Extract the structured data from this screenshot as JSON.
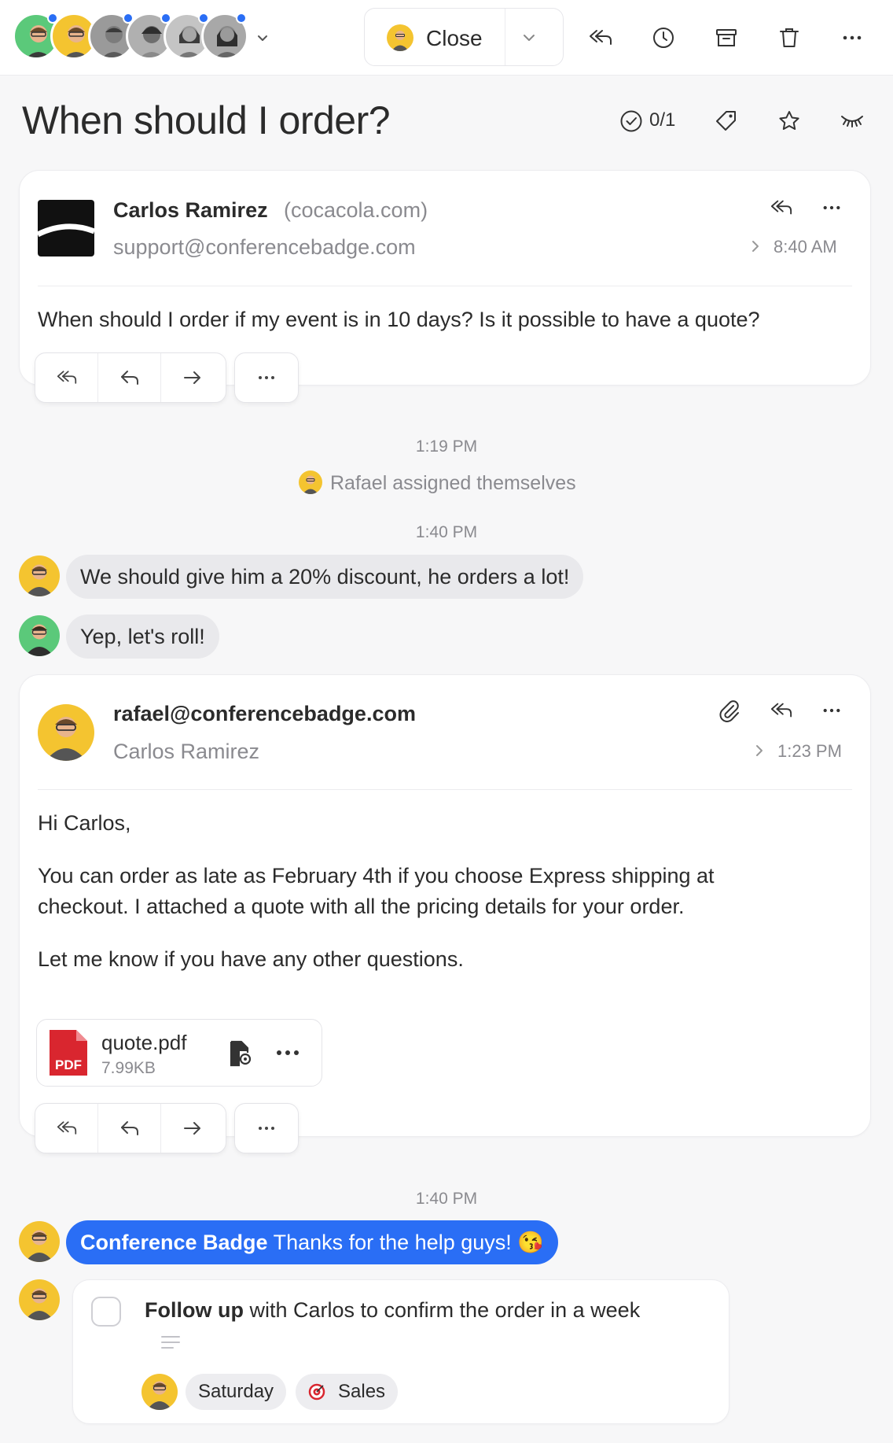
{
  "toolbar": {
    "close_label": "Close",
    "avatars": [
      {
        "name": "avatar-1",
        "bg": "#5bc97a",
        "presence": true
      },
      {
        "name": "avatar-2",
        "bg": "#f4c430",
        "presence": false
      },
      {
        "name": "avatar-3",
        "bg": "#9a9a9a",
        "presence": true
      },
      {
        "name": "avatar-4",
        "bg": "#b0b0b0",
        "presence": true
      },
      {
        "name": "avatar-5",
        "bg": "#c4c4c4",
        "presence": true
      },
      {
        "name": "avatar-6",
        "bg": "#a8a8a8",
        "presence": true
      }
    ]
  },
  "title": {
    "text": "When should I order?",
    "task_count": "0/1"
  },
  "email1": {
    "sender": "Carlos Ramirez",
    "domain": "(cocacola.com)",
    "to": "support@conferencebadge.com",
    "time": "8:40 AM",
    "body": "When should I order if my event is in 10 days? Is it possible to have a quote?"
  },
  "timeline": {
    "time1": "1:19 PM",
    "event": "Rafael assigned themselves",
    "time2": "1:40 PM",
    "time3": "1:40 PM"
  },
  "chat": {
    "msg1": "We should give him a 20% discount, he orders a lot!",
    "msg2": "Yep, let's roll!",
    "msg3_mention": "Conference Badge",
    "msg3_text": " Thanks for the help guys! 😘"
  },
  "email2": {
    "sender": "rafael@conferencebadge.com",
    "to": "Carlos Ramirez",
    "time": "1:23 PM",
    "greeting": "Hi Carlos,",
    "para1_line1": "You can order as late as February 4th if you choose Express shipping at",
    "para1_line2": "checkout. I attached a quote with all the pricing details for your order.",
    "para2": "Let me know if you have any other questions.",
    "attachment": {
      "name": "quote.pdf",
      "size": "7.99KB",
      "type": "PDF"
    }
  },
  "task": {
    "bold": "Follow up",
    "text": " with Carlos to confirm the order in a week",
    "due": "Saturday",
    "tag": "Sales"
  },
  "colors": {
    "accent": "#2a6ef5",
    "pdf": "#d9262f",
    "yellow_avatar": "#f4c430",
    "green_avatar": "#5bc97a"
  }
}
